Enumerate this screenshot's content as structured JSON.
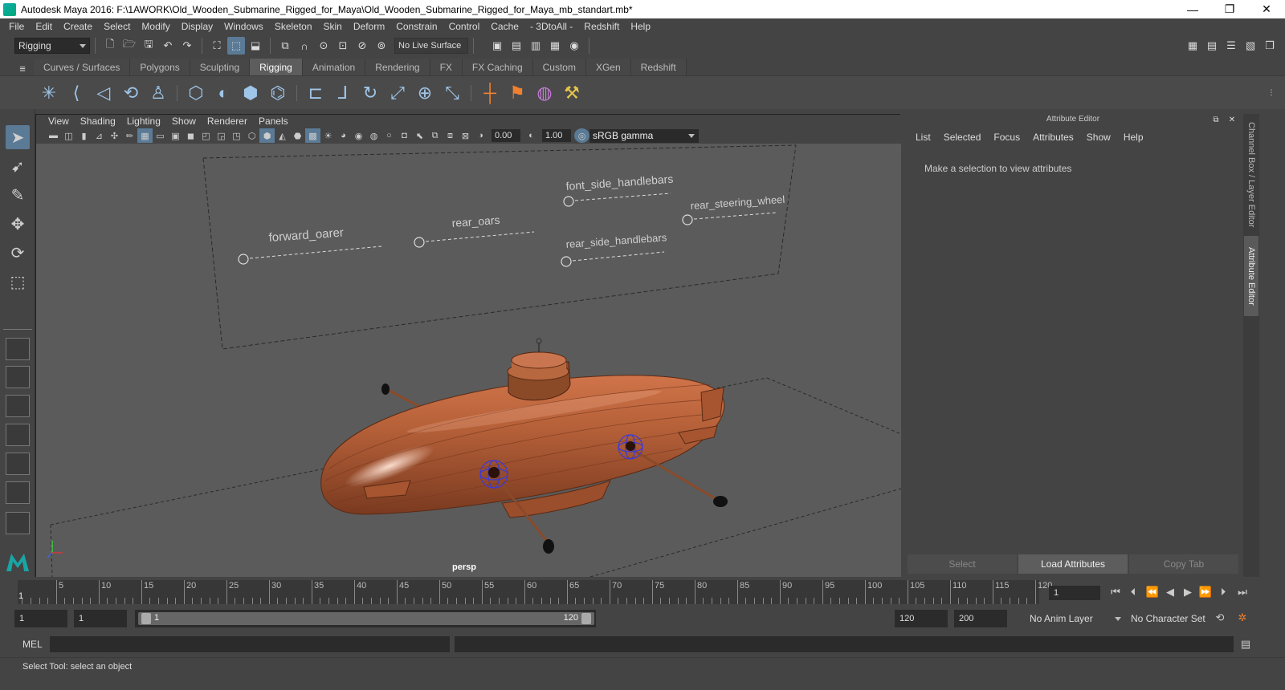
{
  "window": {
    "title": "Autodesk Maya 2016: F:\\1AWORK\\Old_Wooden_Submarine_Rigged_for_Maya\\Old_Wooden_Submarine_Rigged_for_Maya_mb_standart.mb*",
    "minimize": "—",
    "restore": "❐",
    "close": "✕"
  },
  "menubar": [
    "File",
    "Edit",
    "Create",
    "Select",
    "Modify",
    "Display",
    "Windows",
    "Skeleton",
    "Skin",
    "Deform",
    "Constrain",
    "Control",
    "Cache",
    "- 3DtoAll -",
    "Redshift",
    "Help"
  ],
  "status": {
    "mode": "Rigging",
    "live_surface": "No Live Surface"
  },
  "shelf_tabs": [
    {
      "label": "Curves / Surfaces",
      "active": false
    },
    {
      "label": "Polygons",
      "active": false
    },
    {
      "label": "Sculpting",
      "active": false
    },
    {
      "label": "Rigging",
      "active": true
    },
    {
      "label": "Animation",
      "active": false
    },
    {
      "label": "Rendering",
      "active": false
    },
    {
      "label": "FX",
      "active": false
    },
    {
      "label": "FX Caching",
      "active": false
    },
    {
      "label": "Custom",
      "active": false
    },
    {
      "label": "XGen",
      "active": false
    },
    {
      "label": "Redshift",
      "active": false
    }
  ],
  "viewport": {
    "menu": [
      "View",
      "Shading",
      "Lighting",
      "Show",
      "Renderer",
      "Panels"
    ],
    "exposure": "0.00",
    "gamma_value": "1.00",
    "color_space": "sRGB gamma",
    "camera": "persp",
    "controls": {
      "forward_oarer": "forward_oarer",
      "rear_oars": "rear_oars",
      "font_side_handlebars": "font_side_handlebars",
      "rear_steering_wheel": "rear_steering_wheel",
      "rear_side_handlebars": "rear_side_handlebars"
    }
  },
  "attribute_editor": {
    "title": "Attribute Editor",
    "menu": [
      "List",
      "Selected",
      "Focus",
      "Attributes",
      "Show",
      "Help"
    ],
    "message": "Make a selection to view attributes",
    "buttons": {
      "select": "Select",
      "load": "Load Attributes",
      "copy": "Copy Tab"
    },
    "side_tabs": {
      "channel_box": "Channel Box / Layer Editor",
      "attribute_editor": "Attribute Editor"
    }
  },
  "timeline": {
    "labels": [
      "5",
      "10",
      "15",
      "20",
      "25",
      "30",
      "35",
      "40",
      "45",
      "50",
      "55",
      "60",
      "65",
      "70",
      "75",
      "80",
      "85",
      "90",
      "95",
      "100",
      "105",
      "110",
      "115",
      "120"
    ],
    "current_marker": "1",
    "current_frame": "1"
  },
  "range": {
    "start": "1",
    "playback_start": "1",
    "slider_start": "1",
    "slider_end": "120",
    "playback_end": "120",
    "end": "200",
    "anim_layer": "No Anim Layer",
    "character_set": "No Character Set"
  },
  "command": {
    "label": "MEL",
    "help": "Select Tool: select an object"
  },
  "colors": {
    "accent": "#5a7a96",
    "submarine_wood": "#b8623a",
    "viewport_bg": "#5b5b5b"
  }
}
